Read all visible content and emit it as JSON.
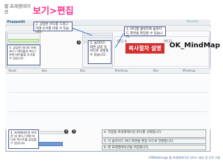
{
  "header": {
    "subtitle": "웹 프레젠테이션",
    "title": "보기>편집"
  },
  "app": {
    "logo": "Prezentit",
    "brand": "BlueInk"
  },
  "callouts": {
    "c1": "1. 마디를 클릭하여 슬라이드 화면을 편집할 수 있습니다.",
    "c2": "2. 삼입된 마디를 드래그하여 순서를 바꿀 수 있습니다.",
    "c3": "3. 삼입된 마디의 하위 마디 / 테이블과 마디 / 하위 테이블을 추가할 수 있습니다.",
    "c4": "3. 슬라이드 화면 삼입 및 마디로 설정할 수 있습니다.",
    "c5": "4. 프레젠테이션 하이픈 내 마디 / 하위 마디와 텍스트를 삼입할 수 있습니다.",
    "c6": "4. 작업할 프레젠테이션 마디를 선택합니다.",
    "c7": "5. 이 슬라이드 마디 화면을 편집 모드로 전환합니다.",
    "c8": "6. 편 프레젠테이션을 저장합니다."
  },
  "slide": {
    "label": "마디 4",
    "label2": "마디1",
    "red_text": "복사절차 설명",
    "mindmap": "OK_MindMap"
  },
  "tabs": [
    "Step1",
    "Box",
    "Box",
    "Mindmap",
    "Box",
    "Mindmap"
  ],
  "footer": "2DWebImage 웹 프레젠테이션 서비스 제공 및 무료 이용"
}
